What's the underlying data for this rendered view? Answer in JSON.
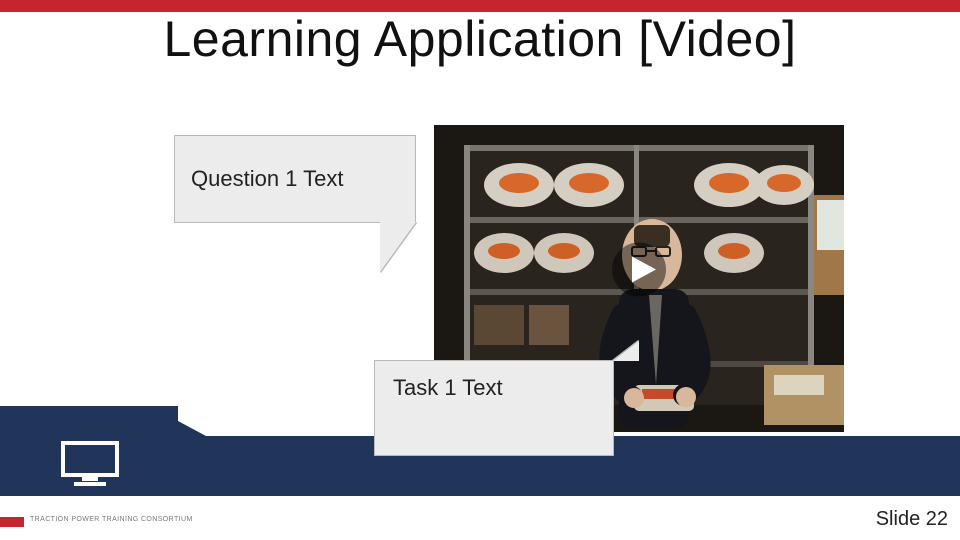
{
  "colors": {
    "brand_red": "#c3272d",
    "brand_navy": "#203559",
    "bubble_bg": "#ececec"
  },
  "title": "Learning Application [Video]",
  "bubbles": {
    "question": {
      "text": "Question 1 Text"
    },
    "task": {
      "text": "Task 1 Text"
    }
  },
  "video": {
    "description": "Embedded video placeholder with play button",
    "play_icon": "play-icon"
  },
  "footer": {
    "icon": "monitor-icon",
    "consortium_label": "TRACTION POWER TRAINING CONSORTIUM",
    "slide_label": "Slide 22"
  }
}
